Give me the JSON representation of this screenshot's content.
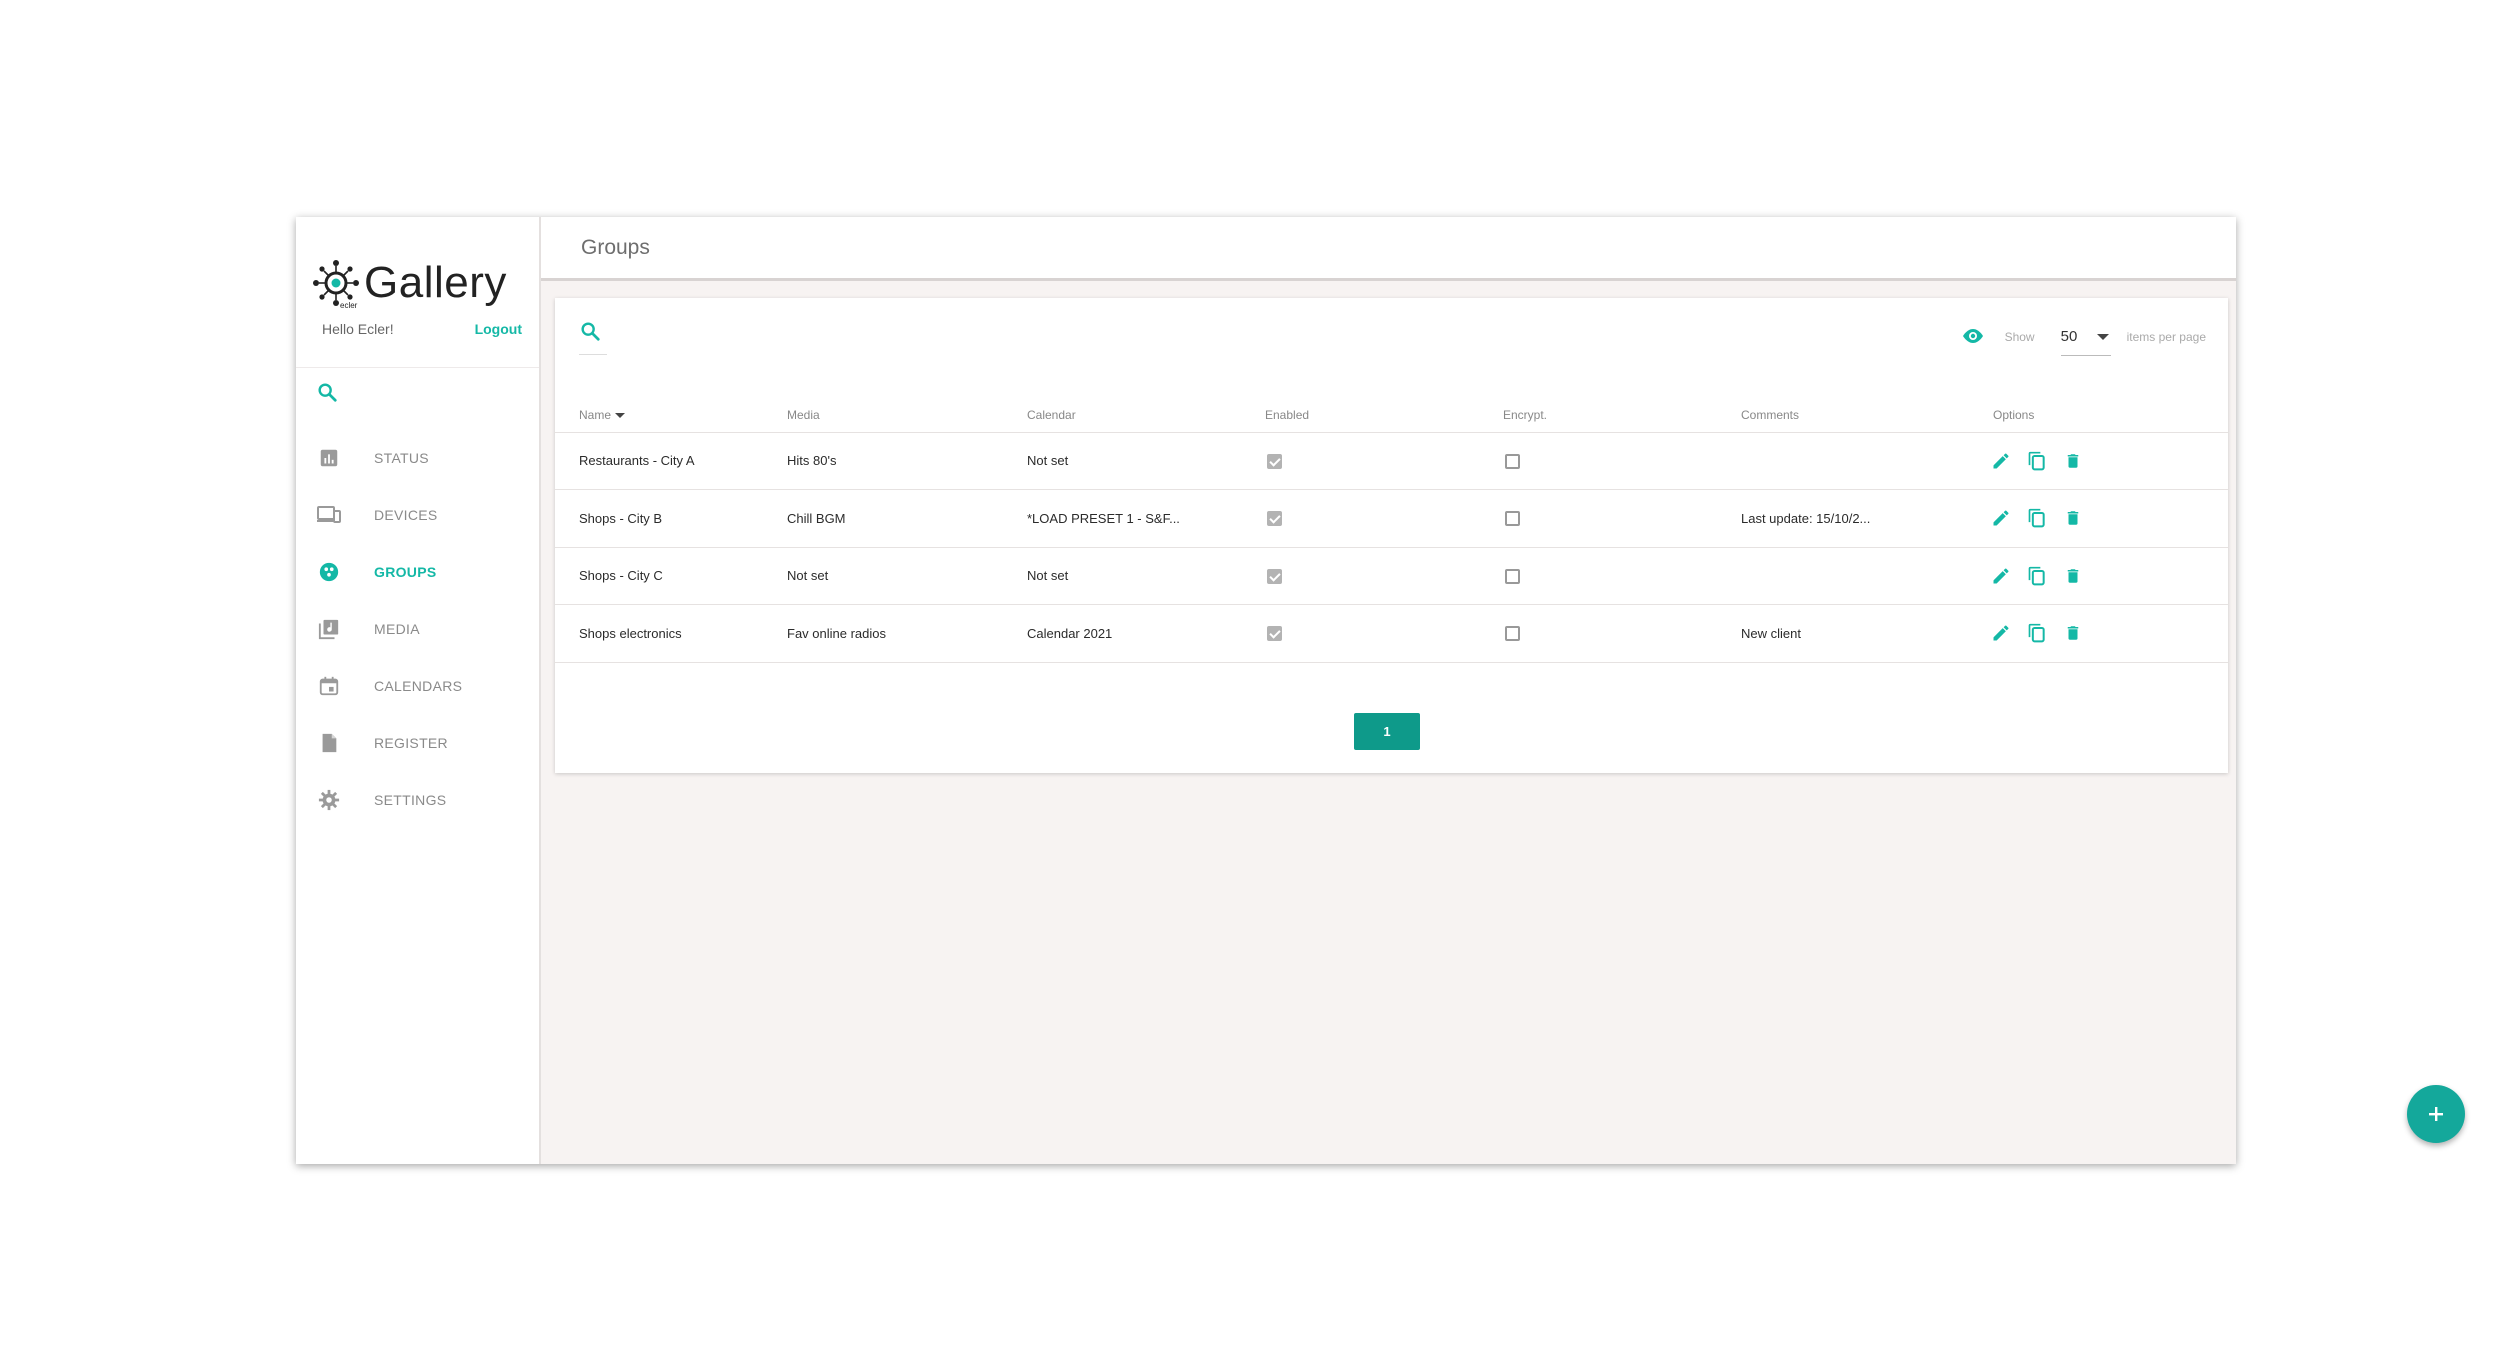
{
  "brand": {
    "name": "Gallery",
    "sub": "ecler"
  },
  "user": {
    "greeting": "Hello Ecler!",
    "logout": "Logout"
  },
  "nav": [
    {
      "key": "status",
      "label": "STATUS",
      "icon": "bar-chart-icon",
      "active": false
    },
    {
      "key": "devices",
      "label": "DEVICES",
      "icon": "devices-icon",
      "active": false
    },
    {
      "key": "groups",
      "label": "GROUPS",
      "icon": "group-icon",
      "active": true
    },
    {
      "key": "media",
      "label": "MEDIA",
      "icon": "library-music-icon",
      "active": false
    },
    {
      "key": "calendars",
      "label": "CALENDARS",
      "icon": "calendar-icon",
      "active": false
    },
    {
      "key": "register",
      "label": "REGISTER",
      "icon": "document-icon",
      "active": false
    },
    {
      "key": "settings",
      "label": "SETTINGS",
      "icon": "gear-icon",
      "active": false
    }
  ],
  "header": {
    "title": "Groups"
  },
  "view": {
    "show_label": "Show",
    "per_page": "50",
    "per_page_label": "items per page"
  },
  "table": {
    "columns": [
      "Name",
      "Media",
      "Calendar",
      "Enabled",
      "Encrypt.",
      "Comments",
      "Options"
    ],
    "rows": [
      {
        "name": "Restaurants - City A",
        "media": "Hits 80's",
        "calendar": "Not set",
        "enabled": true,
        "encrypt": false,
        "comments": ""
      },
      {
        "name": "Shops - City B",
        "media": "Chill BGM",
        "calendar": "*LOAD PRESET 1 - S&F...",
        "enabled": true,
        "encrypt": false,
        "comments": "Last update: 15/10/2..."
      },
      {
        "name": "Shops - City C",
        "media": "Not set",
        "calendar": "Not set",
        "enabled": true,
        "encrypt": false,
        "comments": ""
      },
      {
        "name": "Shops electronics",
        "media": "Fav online radios",
        "calendar": "Calendar 2021",
        "enabled": true,
        "encrypt": false,
        "comments": "New client"
      }
    ]
  },
  "pagination": {
    "current": "1"
  },
  "colors": {
    "accent": "#14b8a6",
    "pager": "#0e9a8a",
    "fab": "#14a89b"
  }
}
